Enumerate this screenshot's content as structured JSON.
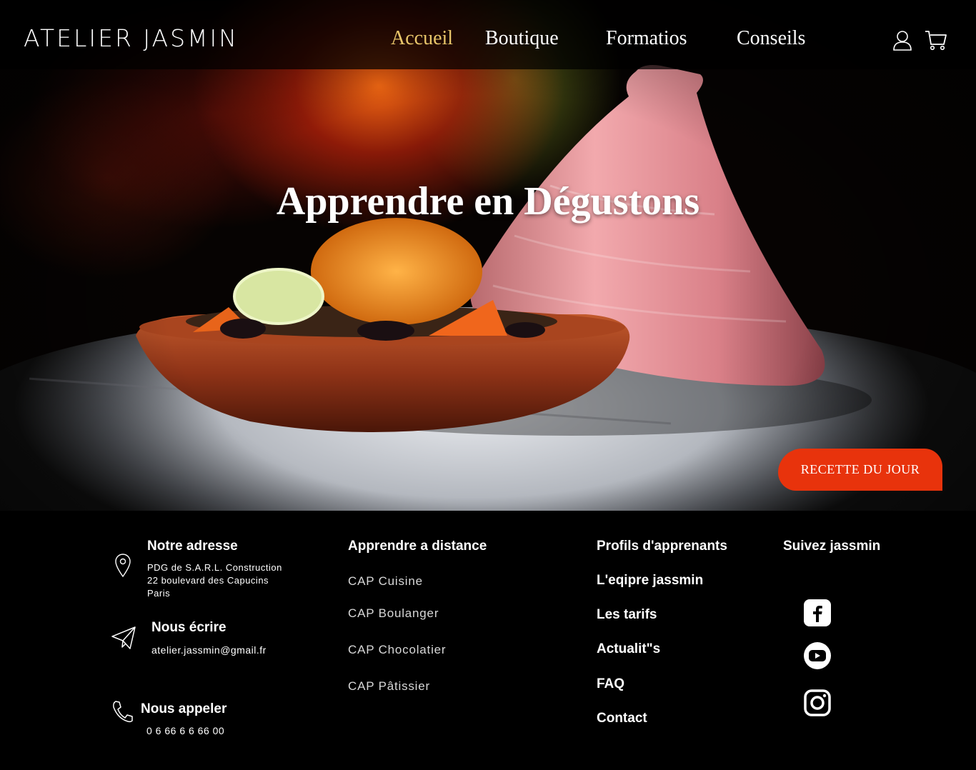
{
  "header": {
    "logo": "ATELIER JASMIN",
    "nav": [
      {
        "label": "Accueil",
        "active": true
      },
      {
        "label": "Boutique",
        "active": false
      },
      {
        "label": "Formatios",
        "active": false
      },
      {
        "label": "Conseils",
        "active": false
      }
    ],
    "icons": [
      "user-icon",
      "cart-icon"
    ],
    "active_color": "#e8c56a"
  },
  "hero": {
    "title": "Apprendre en Dégustons",
    "cta_label": "RECETTE DU JOUR",
    "cta_color": "#e8330c"
  },
  "footer": {
    "address": {
      "heading": "Notre adresse",
      "line1": "PDG de S.A.R.L. Construction",
      "line2": "22 boulevard des Capucins",
      "line3": "Paris"
    },
    "write": {
      "heading": "Nous écrire",
      "email": "atelier.jassmin@gmail.fr"
    },
    "call": {
      "heading": "Nous appeler",
      "phone": "0 6 66 6 6 66 00"
    },
    "distance": {
      "heading": "Apprendre a distance",
      "links": [
        "CAP Cuisine",
        "CAP Boulanger",
        "CAP Chocolatier",
        "CAP Pâtissier"
      ]
    },
    "info_links": [
      "Profils d'apprenants",
      "L'eqipre jassmin",
      "Les tarifs",
      "Actualit\"s",
      "FAQ",
      "Contact"
    ],
    "social": {
      "heading": "Suivez jassmin",
      "icons": [
        "facebook-icon",
        "youtube-icon",
        "instagram-icon"
      ]
    }
  }
}
